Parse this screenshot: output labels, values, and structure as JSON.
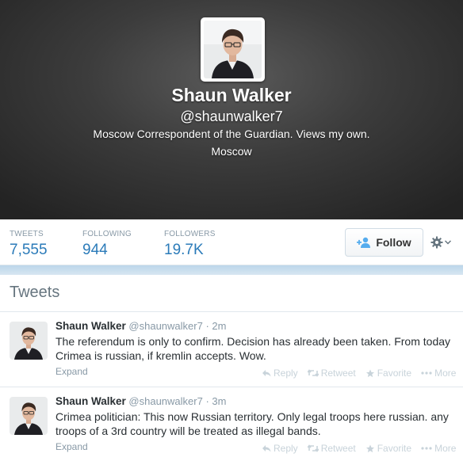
{
  "profile": {
    "name": "Shaun Walker",
    "handle": "@shaunwalker7",
    "bio": "Moscow Correspondent of the Guardian. Views my own.",
    "location": "Moscow"
  },
  "stats": [
    {
      "label": "TWEETS",
      "value": "7,555"
    },
    {
      "label": "FOLLOWING",
      "value": "944"
    },
    {
      "label": "FOLLOWERS",
      "value": "19.7K"
    }
  ],
  "actions": {
    "follow_label": "Follow",
    "follow_icon": "add-user-icon",
    "settings_icon": "gear-icon"
  },
  "tweets_section": {
    "heading": "Tweets"
  },
  "tweets": [
    {
      "author": "Shaun Walker",
      "handle": "@shaunwalker7",
      "time": "2m",
      "text": "The referendum is only to confirm. Decision has already been taken. From today Crimea is russian, if kremlin accepts. Wow.",
      "expand": "Expand",
      "reply": "Reply",
      "retweet": "Retweet",
      "favorite": "Favorite",
      "more": "More"
    },
    {
      "author": "Shaun Walker",
      "handle": "@shaunwalker7",
      "time": "3m",
      "text": "Crimea politician: This now Russian territory. Only legal troops here russian. any troops of a 3rd country will be treated as illegal bands.",
      "expand": "Expand",
      "reply": "Reply",
      "retweet": "Retweet",
      "favorite": "Favorite",
      "more": "More"
    }
  ],
  "colors": {
    "link_blue": "#2b7bb9",
    "muted_gray": "#8899a6",
    "divider_blue": "#bcd6ea"
  }
}
